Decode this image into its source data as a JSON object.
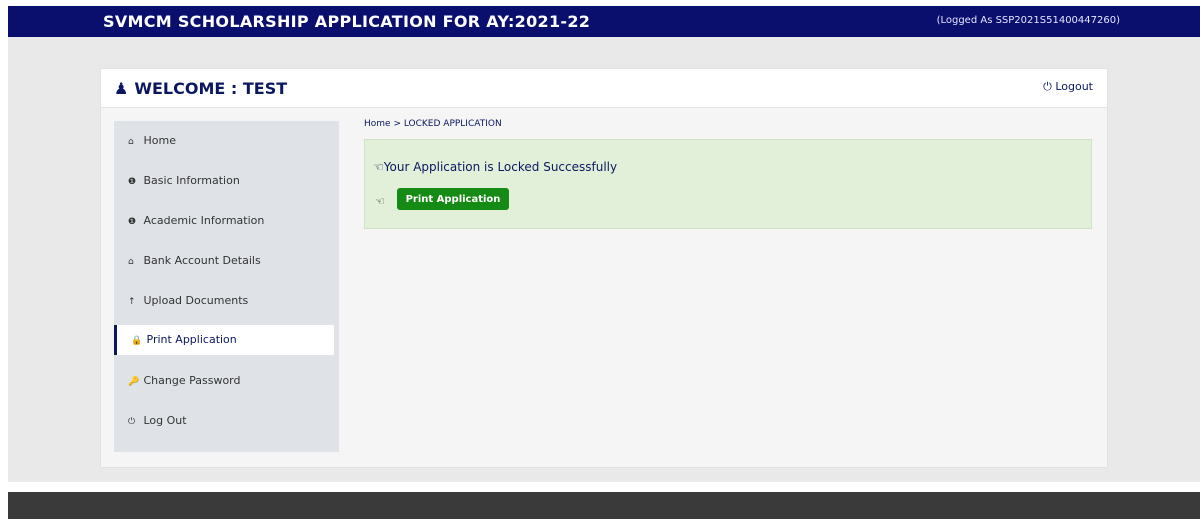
{
  "header": {
    "title": "SVMCM SCHOLARSHIP APPLICATION FOR AY:2021-22",
    "logged_as": "(Logged As SSP2021S51400447260)"
  },
  "panel": {
    "welcome": "WELCOME : TEST",
    "logout_label": "Logout"
  },
  "sidebar": {
    "items": [
      {
        "label": "Home",
        "icon": "home-icon"
      },
      {
        "label": "Basic Information",
        "icon": "info-icon"
      },
      {
        "label": "Academic Information",
        "icon": "info-icon"
      },
      {
        "label": "Bank Account Details",
        "icon": "bank-icon"
      },
      {
        "label": "Upload Documents",
        "icon": "upload-icon"
      },
      {
        "label": "Print Application",
        "icon": "lock-icon",
        "active": true
      },
      {
        "label": "Change Password",
        "icon": "key-icon"
      },
      {
        "label": "Log Out",
        "icon": "power-icon"
      }
    ]
  },
  "main": {
    "breadcrumb": "Home > LOCKED APPLICATION",
    "alert_message": "Your Application is Locked Successfully",
    "print_button": "Print Application"
  },
  "colors": {
    "header_bg": "#0a0f6e",
    "accent": "#0b1860",
    "success_bg": "#e2f0da",
    "button_green": "#158a15"
  }
}
